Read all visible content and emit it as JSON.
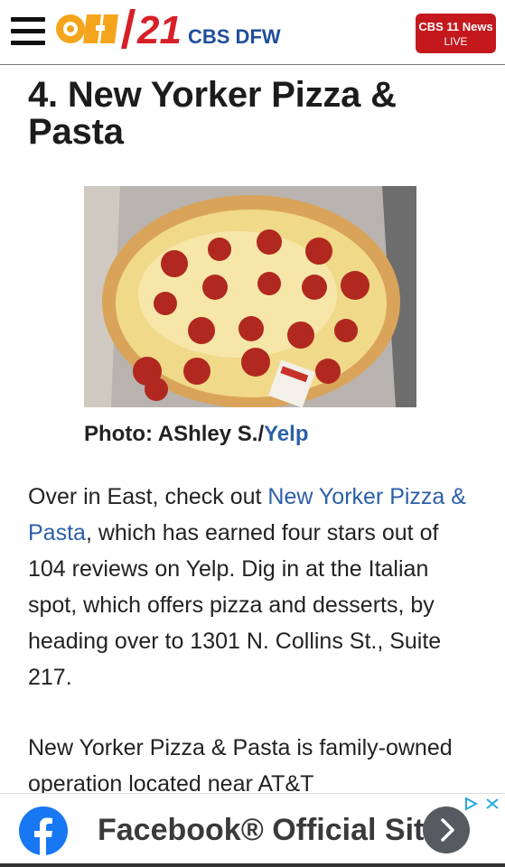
{
  "header": {
    "logo_text": "CBS DFW",
    "live_button": {
      "line1": "CBS 11 News",
      "line2": "LIVE"
    }
  },
  "article": {
    "title": "4. New Yorker Pizza & Pasta",
    "caption": {
      "prefix": "Photo: AShley S./",
      "link": "Yelp"
    },
    "paragraph1": {
      "before_link": "Over in East, check out ",
      "link": "New Yorker Pizza & Pasta",
      "after_link": ", which has earned four stars out of 104 reviews on Yelp. Dig in at the Italian spot, which offers pizza and desserts, by heading over to 1301 N. Collins St., Suite 217."
    },
    "paragraph2": "New Yorker Pizza & Pasta is family-owned operation located near AT&T"
  },
  "ad": {
    "text": "Facebook® Official Site",
    "colors": {
      "facebook": "#1877f2",
      "arrow": "#555b61"
    }
  },
  "colors": {
    "link": "#2b5fa8",
    "live": "#c4181d",
    "logo_orange": "#f5a51c",
    "logo_red": "#d62027",
    "logo_blue": "#1f4e9c"
  }
}
